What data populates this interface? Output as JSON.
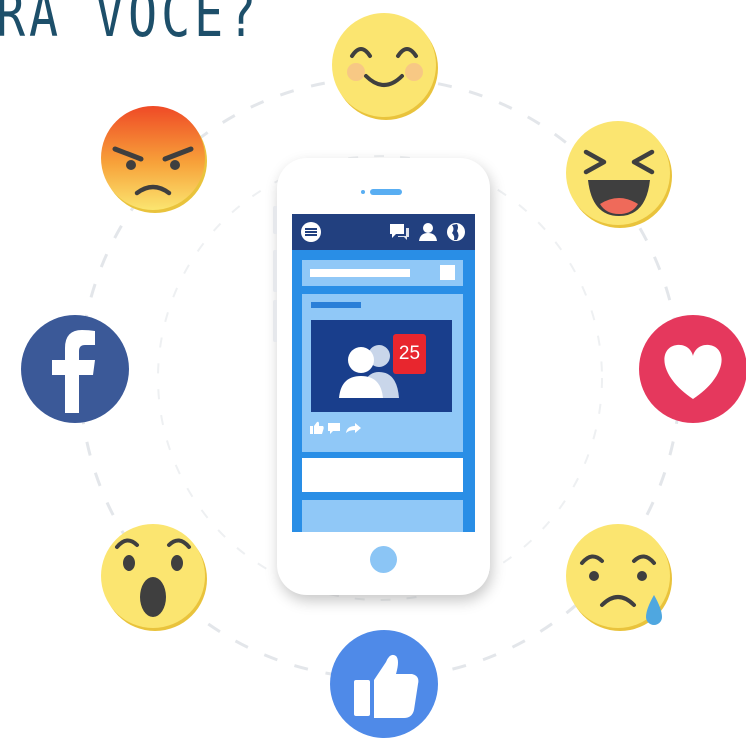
{
  "header": {
    "title": "RA VOCÊ?"
  },
  "phone": {
    "notification_count": "25"
  },
  "reactions": [
    {
      "name": "happy",
      "color": "#fbe570"
    },
    {
      "name": "laughing",
      "color": "#fbe570"
    },
    {
      "name": "love",
      "color": "#e5385d"
    },
    {
      "name": "sad",
      "color": "#fbe570"
    },
    {
      "name": "like",
      "color": "#4f8ae8"
    },
    {
      "name": "wow",
      "color": "#fbe570"
    },
    {
      "name": "facebook",
      "color": "#3b5998"
    },
    {
      "name": "angry",
      "color": "#ef5a2a"
    }
  ],
  "colors": {
    "heading": "#1d4f6a",
    "phone_topbar": "#22407f",
    "screen_blue": "#298ee6",
    "light_blue": "#90c8f7",
    "badge_red": "#e8262e"
  }
}
